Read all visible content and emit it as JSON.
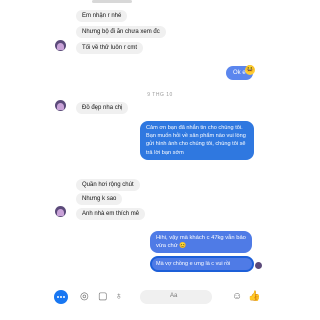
{
  "top": {
    "timestamp_cut": "",
    "partial_text": ""
  },
  "messages": [
    {
      "id": "m1",
      "side": "in",
      "text": "Em nhận r nhé"
    },
    {
      "id": "m2",
      "side": "in",
      "text": "Nhưng bộ đi ăn chưa xem đc"
    },
    {
      "id": "m3",
      "side": "in",
      "text": "Tối về thử luôn r cmt"
    },
    {
      "id": "m4",
      "side": "out",
      "text": "Ok e"
    },
    {
      "id": "m5",
      "side": "in",
      "text": "Đồ đẹp nha chị"
    },
    {
      "id": "m6",
      "side": "out",
      "text": "Cảm ơn bạn đã nhắn tin cho chúng tôi. Bạn muốn hỏi về sản phẩm nào vui lòng gửi hình ảnh cho chúng tôi, chúng tôi sẽ trả lời bạn sớm"
    },
    {
      "id": "m7",
      "side": "in",
      "text": "Quần hơi rộng chút"
    },
    {
      "id": "m8",
      "side": "in",
      "text": "Nhưng k sao"
    },
    {
      "id": "m9",
      "side": "in",
      "text": "Anh nhà em thích mê"
    },
    {
      "id": "m10",
      "side": "out",
      "text": "Hihi, vậy mà khách c 47kg vẫn bảo vừa chứ 😊"
    },
    {
      "id": "m11",
      "side": "out",
      "text": "Mà vợ chồng e ưng là c vui rồi"
    }
  ],
  "divider": {
    "text": "9 THG 10"
  },
  "composer": {
    "input_placeholder": "Aa",
    "icons": [
      "more-icon",
      "camera-icon",
      "image-icon",
      "mic-icon",
      "emoji-icon",
      "like-icon"
    ]
  },
  "colors": {
    "accent": "#1877f2",
    "bubble_in": "#f0f0f0"
  }
}
